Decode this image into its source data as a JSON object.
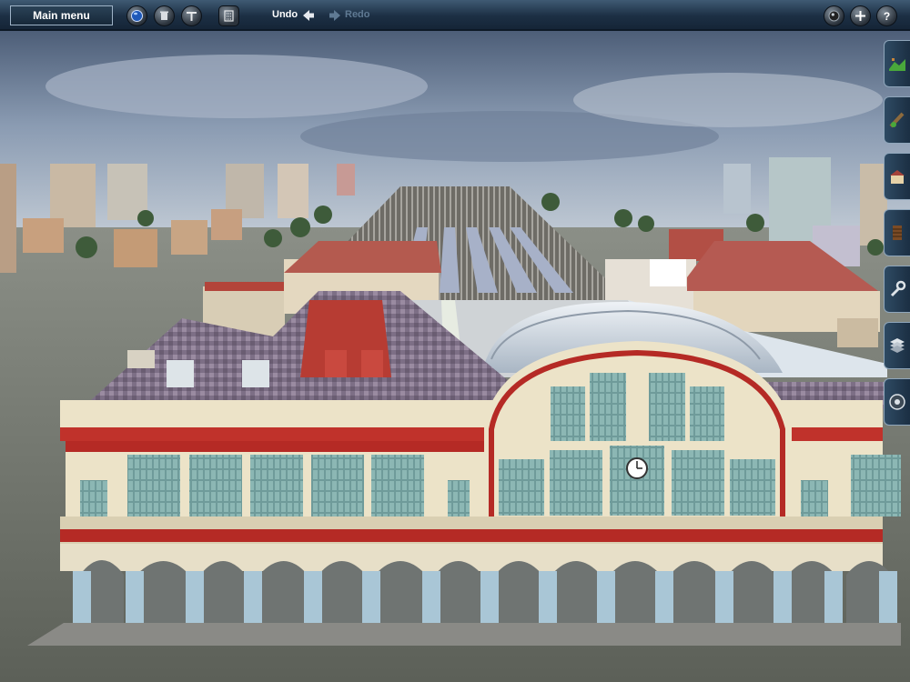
{
  "toolbar": {
    "main_menu_label": "Main menu",
    "undo_label": "Undo",
    "redo_label": "Redo"
  },
  "icons": {
    "left": [
      "globe-icon",
      "trash-icon",
      "tools-icon",
      "calculator-icon"
    ],
    "right": [
      "camera-icon",
      "add-icon",
      "help-icon"
    ],
    "side": [
      "terrain-icon",
      "track-icon",
      "building-icon",
      "rolling-stock-icon",
      "settings-wrench-icon",
      "layers-icon",
      "view-dial-icon"
    ]
  },
  "colors": {
    "toolbar_bg": "#1c2f44",
    "accent_green": "#49a83b",
    "facade_cream": "#ece3c8",
    "facade_red": "#b52a25"
  }
}
